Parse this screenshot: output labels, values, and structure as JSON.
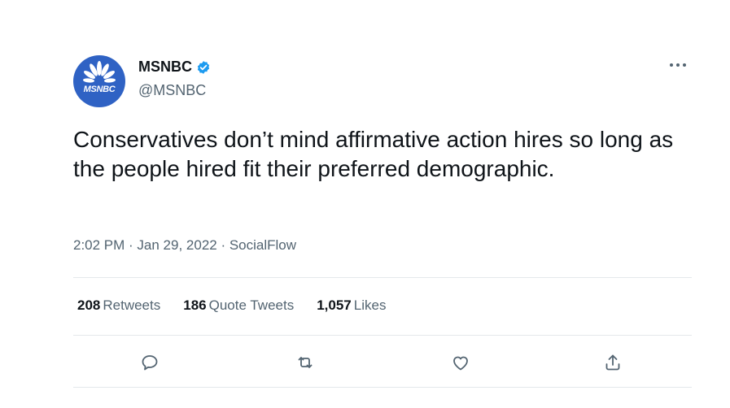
{
  "account": {
    "display_name": "MSNBC",
    "handle": "@MSNBC",
    "avatar_text": "MSNBC",
    "verified": true
  },
  "tweet": {
    "text": "Conservatives don’t mind affirmative action hires so long as the people hired fit their preferred demographic.",
    "time": "2:02 PM",
    "date": "Jan 29, 2022",
    "source": "SocialFlow",
    "separator": " · "
  },
  "stats": {
    "retweets": {
      "count": "208",
      "label": "Retweets"
    },
    "quote_tweets": {
      "count": "186",
      "label": "Quote Tweets"
    },
    "likes": {
      "count": "1,057",
      "label": "Likes"
    }
  },
  "icons": {
    "more": "more-options-icon",
    "reply": "reply-icon",
    "retweet": "retweet-icon",
    "like": "like-icon",
    "share": "share-icon",
    "verified": "verified-badge-icon"
  },
  "colors": {
    "brand_avatar": "#2f62c4",
    "verified": "#1d9bf0",
    "text_primary": "#0f1419",
    "text_secondary": "#536471",
    "divider": "#e4e8eb"
  }
}
